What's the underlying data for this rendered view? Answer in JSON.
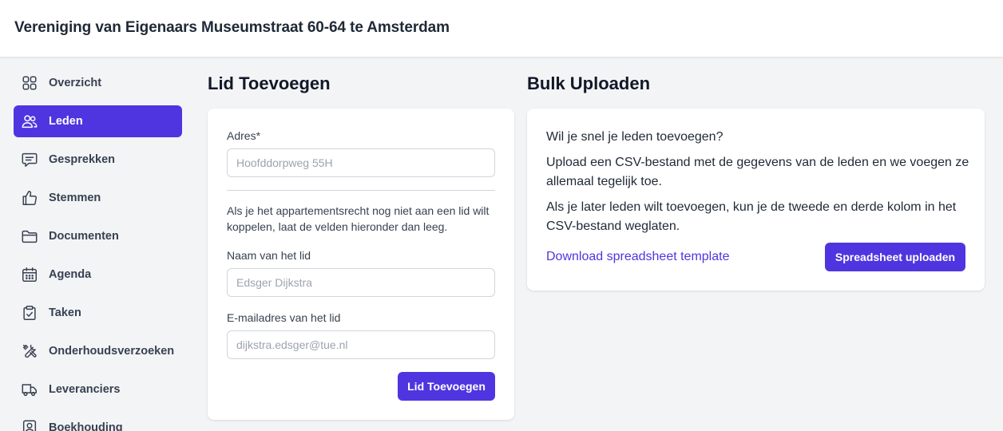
{
  "header": {
    "title": "Vereniging van Eigenaars Museumstraat 60-64 te Amsterdam"
  },
  "sidebar": {
    "items": [
      {
        "label": "Overzicht",
        "icon": "grid-icon",
        "active": false
      },
      {
        "label": "Leden",
        "icon": "users-icon",
        "active": true
      },
      {
        "label": "Gesprekken",
        "icon": "chat-icon",
        "active": false
      },
      {
        "label": "Stemmen",
        "icon": "thumbs-up-icon",
        "active": false
      },
      {
        "label": "Documenten",
        "icon": "folder-icon",
        "active": false
      },
      {
        "label": "Agenda",
        "icon": "calendar-icon",
        "active": false
      },
      {
        "label": "Taken",
        "icon": "clipboard-check-icon",
        "active": false
      },
      {
        "label": "Onderhoudsverzoeken",
        "icon": "tools-icon",
        "active": false
      },
      {
        "label": "Leveranciers",
        "icon": "truck-icon",
        "active": false
      },
      {
        "label": "Boekhouding",
        "icon": "calculator-icon",
        "active": false
      }
    ]
  },
  "add_member": {
    "title": "Lid Toevoegen",
    "address_label": "Adres*",
    "address_placeholder": "Hoofddorpweg 55H",
    "address_value": "",
    "help_text": "Als je het appartementsrecht nog niet aan een lid wilt koppelen, laat de velden hieronder dan leeg.",
    "name_label": "Naam van het lid",
    "name_placeholder": "Edsger Dijkstra",
    "name_value": "",
    "email_label": "E-mailadres van het lid",
    "email_placeholder": "dijkstra.edsger@tue.nl",
    "email_value": "",
    "submit_label": "Lid Toevoegen"
  },
  "bulk_upload": {
    "title": "Bulk Uploaden",
    "paragraph_1": "Wil je snel je leden toevoegen?",
    "paragraph_2": "Upload een CSV-bestand met de gegevens van de leden en we voegen ze allemaal tegelijk toe.",
    "paragraph_3": "Als je later leden wilt toevoegen, kun je de tweede en derde kolom in het CSV-bestand weglaten.",
    "download_link": "Download spreadsheet template",
    "upload_button": "Spreadsheet uploaden"
  },
  "colors": {
    "accent": "#4f35e0",
    "background": "#f3f4f6",
    "card": "#ffffff"
  }
}
